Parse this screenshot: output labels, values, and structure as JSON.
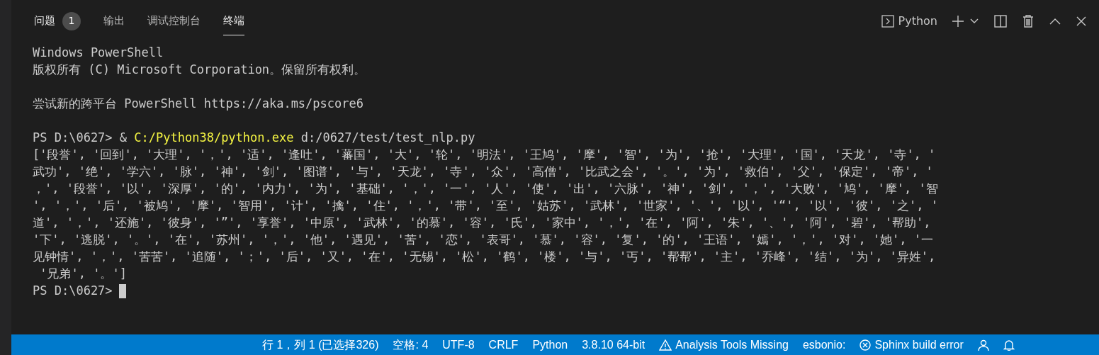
{
  "tabs": [
    {
      "label": "问题",
      "badge": "1",
      "selected": false
    },
    {
      "label": "输出",
      "selected": false
    },
    {
      "label": "调试控制台",
      "selected": false
    },
    {
      "label": "终端",
      "selected": true
    }
  ],
  "toolbar": {
    "terminal_name": "Python"
  },
  "terminal": [
    {
      "kind": "plain",
      "text": "Windows PowerShell"
    },
    {
      "kind": "plain",
      "text": "版权所有 (C) Microsoft Corporation。保留所有权利。"
    },
    {
      "kind": "blank"
    },
    {
      "kind": "plain",
      "text": "尝试新的跨平台 PowerShell https://aka.ms/pscore6"
    },
    {
      "kind": "blank"
    },
    {
      "kind": "command",
      "prompt": "PS D:\\0627> &",
      "program": "C:/Python38/python.exe",
      "args": "d:/0627/test/test_nlp.py"
    },
    {
      "kind": "plain",
      "text": "['段誉', '回到', '大理', '，', '适', '逢吐', '蕃国', '大', '轮', '明法', '王鸠', '摩', '智', '为', '抢', '大理', '国', '天龙', '寺', '"
    },
    {
      "kind": "plain",
      "text": "武功', '绝', '学六', '脉', '神', '剑', '图谱', '与', '天龙', '寺', '众', '高僧', '比武之会', '。', '为', '救伯', '父', '保定', '帝', '"
    },
    {
      "kind": "plain",
      "text": "，', '段誉', '以', '深厚', '的', '内力', '为', '基础', '，', '一', '人', '使', '出', '六脉', '神', '剑', '，', '大败', '鸠', '摩', '智"
    },
    {
      "kind": "plain",
      "text": "', '，', '后', '被鸠', '摩', '智用', '计', '擒', '住', '，', '带', '至', '姑苏', '武林', '世家', '、', '以', '“', '以', '彼', '之', '"
    },
    {
      "kind": "plain",
      "text": "道', '，', '还施', '彼身', '”', '享誉', '中原', '武林', '的慕', '容', '氏', '家中', '，', '在', '阿', '朱', '、', '阿', '碧', '帮助',"
    },
    {
      "kind": "plain",
      "text": "'下', '逃脱', '。', '在', '苏州', '，', '他', '遇见', '苦', '恋', '表哥', '慕', '容', '复', '的', '王语', '嫣', '，', '对', '她', '一"
    },
    {
      "kind": "plain",
      "text": "见钟情', '，', '苦苦', '追随', '；', '后', '又', '在', '无锡', '松', '鹤', '楼', '与', '丐', '帮帮', '主', '乔峰', '结', '为', '异姓',"
    },
    {
      "kind": "plain",
      "text": " '兄弟', '。']"
    },
    {
      "kind": "prompt",
      "prompt": "PS D:\\0627>"
    }
  ],
  "status_bar": [
    {
      "kind": "text",
      "text": "行 1，列 1 (已选择326)"
    },
    {
      "kind": "text",
      "text": "空格: 4"
    },
    {
      "kind": "text",
      "text": "UTF-8"
    },
    {
      "kind": "text",
      "text": "CRLF"
    },
    {
      "kind": "text",
      "text": "Python"
    },
    {
      "kind": "text",
      "text": "3.8.10 64-bit"
    },
    {
      "kind": "warning",
      "text": "Analysis Tools Missing"
    },
    {
      "kind": "text",
      "text": "esbonio:"
    },
    {
      "kind": "error",
      "text": "Sphinx build error"
    },
    {
      "kind": "person"
    },
    {
      "kind": "bell"
    }
  ]
}
